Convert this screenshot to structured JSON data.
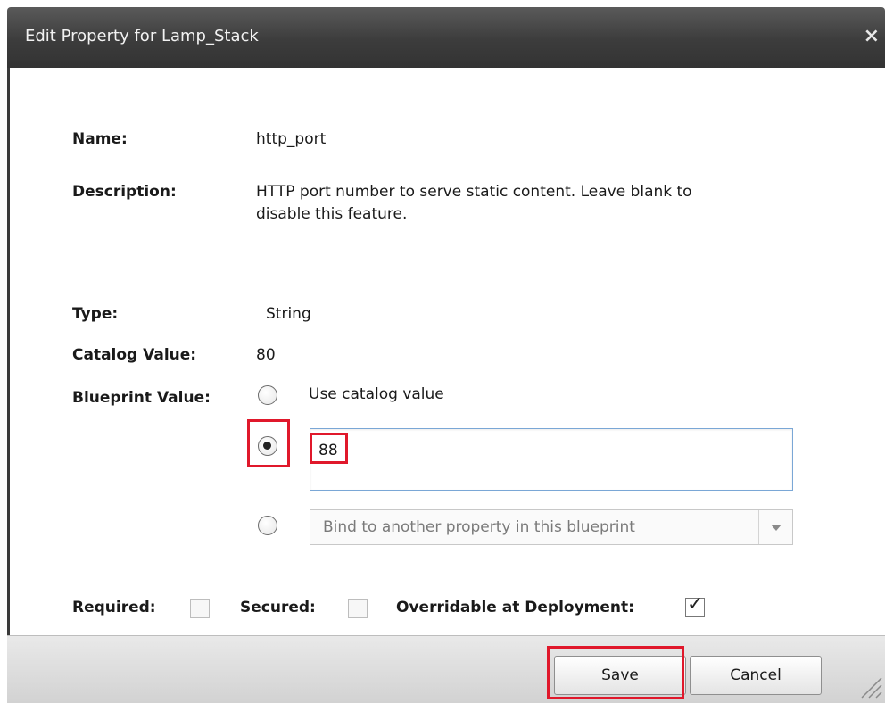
{
  "dialog": {
    "title": "Edit Property for Lamp_Stack",
    "close_glyph": "×"
  },
  "fields": {
    "name_label": "Name:",
    "name_value": "http_port",
    "description_label": "Description:",
    "description_line1": "HTTP port number to serve static content.  Leave blank to",
    "description_line2": "disable this feature.",
    "type_label": "Type:",
    "type_value": "String",
    "catalog_label": "Catalog Value:",
    "catalog_value": "80",
    "blueprint_label": "Blueprint Value:"
  },
  "blueprint_options": {
    "use_catalog_label": "Use catalog value",
    "custom_value": "88",
    "selected_option": "custom",
    "bind_select_value": "Bind to another property in this blueprint"
  },
  "flags": {
    "required_label": "Required:",
    "required_checked": false,
    "secured_label": "Secured:",
    "secured_checked": false,
    "overridable_label": "Overridable at Deployment:",
    "overridable_checked": true
  },
  "buttons": {
    "save_label": "Save",
    "cancel_label": "Cancel"
  },
  "icons": {
    "close": "close-icon",
    "dropdown": "chevron-down-icon",
    "checkmark": "checkmark-icon",
    "resize": "resize-grip-icon"
  },
  "colors": {
    "titlebar": "#3c3c3c",
    "highlight": "#e0182b",
    "input_focus_border": "#7aa7d6"
  }
}
